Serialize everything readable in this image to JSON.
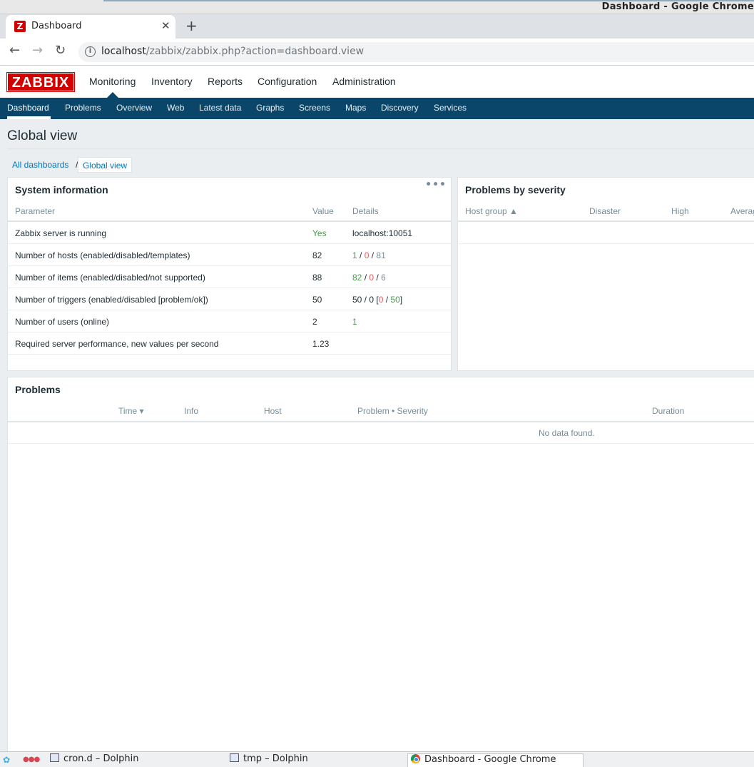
{
  "window": {
    "title": "Dashboard - Google Chrome"
  },
  "browser": {
    "tab_title": "Dashboard",
    "tab_favicon": "Z",
    "tab_close": "✕",
    "new_tab": "+",
    "back": "←",
    "forward": "→",
    "reload": "↻",
    "info": "i",
    "url_host": "localhost",
    "url_path": "/zabbix/zabbix.php?action=dashboard.view"
  },
  "zabbix": {
    "logo": "ZABBIX",
    "top_menu": [
      "Monitoring",
      "Inventory",
      "Reports",
      "Configuration",
      "Administration"
    ],
    "sub_menu": [
      "Dashboard",
      "Problems",
      "Overview",
      "Web",
      "Latest data",
      "Graphs",
      "Screens",
      "Maps",
      "Discovery",
      "Services"
    ],
    "colors": {
      "brand": "#d40000",
      "nav": "#0a466a",
      "link": "#0275b8",
      "ok": "#429e47",
      "problem": "#e45959"
    }
  },
  "page": {
    "title": "Global view",
    "breadcrumb": {
      "root": "All dashboards",
      "separator": "/",
      "current": "Global view"
    }
  },
  "system_information": {
    "title": "System information",
    "menu": "•••",
    "headers": {
      "parameter": "Parameter",
      "value": "Value",
      "details": "Details"
    },
    "rows": [
      {
        "parameter": "Zabbix server is running",
        "value": "Yes",
        "details": "localhost:10051"
      },
      {
        "parameter": "Number of hosts (enabled/disabled/templates)",
        "value": "82",
        "d1": "1",
        "d2": "0",
        "d3": "81"
      },
      {
        "parameter": "Number of items (enabled/disabled/not supported)",
        "value": "88",
        "d1": "82",
        "d2": "0",
        "d3": "6"
      },
      {
        "parameter": "Number of triggers (enabled/disabled [problem/ok])",
        "value": "50",
        "d1": "50 / 0 [",
        "d2": "0",
        "d3": "50",
        "d4": "]"
      },
      {
        "parameter": "Number of users (online)",
        "value": "2",
        "d1": "1"
      },
      {
        "parameter": "Required server performance, new values per second",
        "value": "1.23"
      }
    ],
    "slash": " / "
  },
  "problems_by_severity": {
    "title": "Problems by severity",
    "headers": {
      "host_group": "Host group ▲",
      "disaster": "Disaster",
      "high": "High",
      "average": "Average"
    }
  },
  "problems": {
    "title": "Problems",
    "headers": {
      "time": "Time ▾",
      "info": "Info",
      "host": "Host",
      "problem_severity": "Problem • Severity",
      "duration": "Duration"
    },
    "empty": "No data found."
  },
  "taskbar": {
    "launcher_icon": "✿",
    "dots": "●●●",
    "tasks": [
      "cron.d – Dolphin",
      "tmp – Dolphin",
      "Dashboard - Google Chrome"
    ]
  }
}
